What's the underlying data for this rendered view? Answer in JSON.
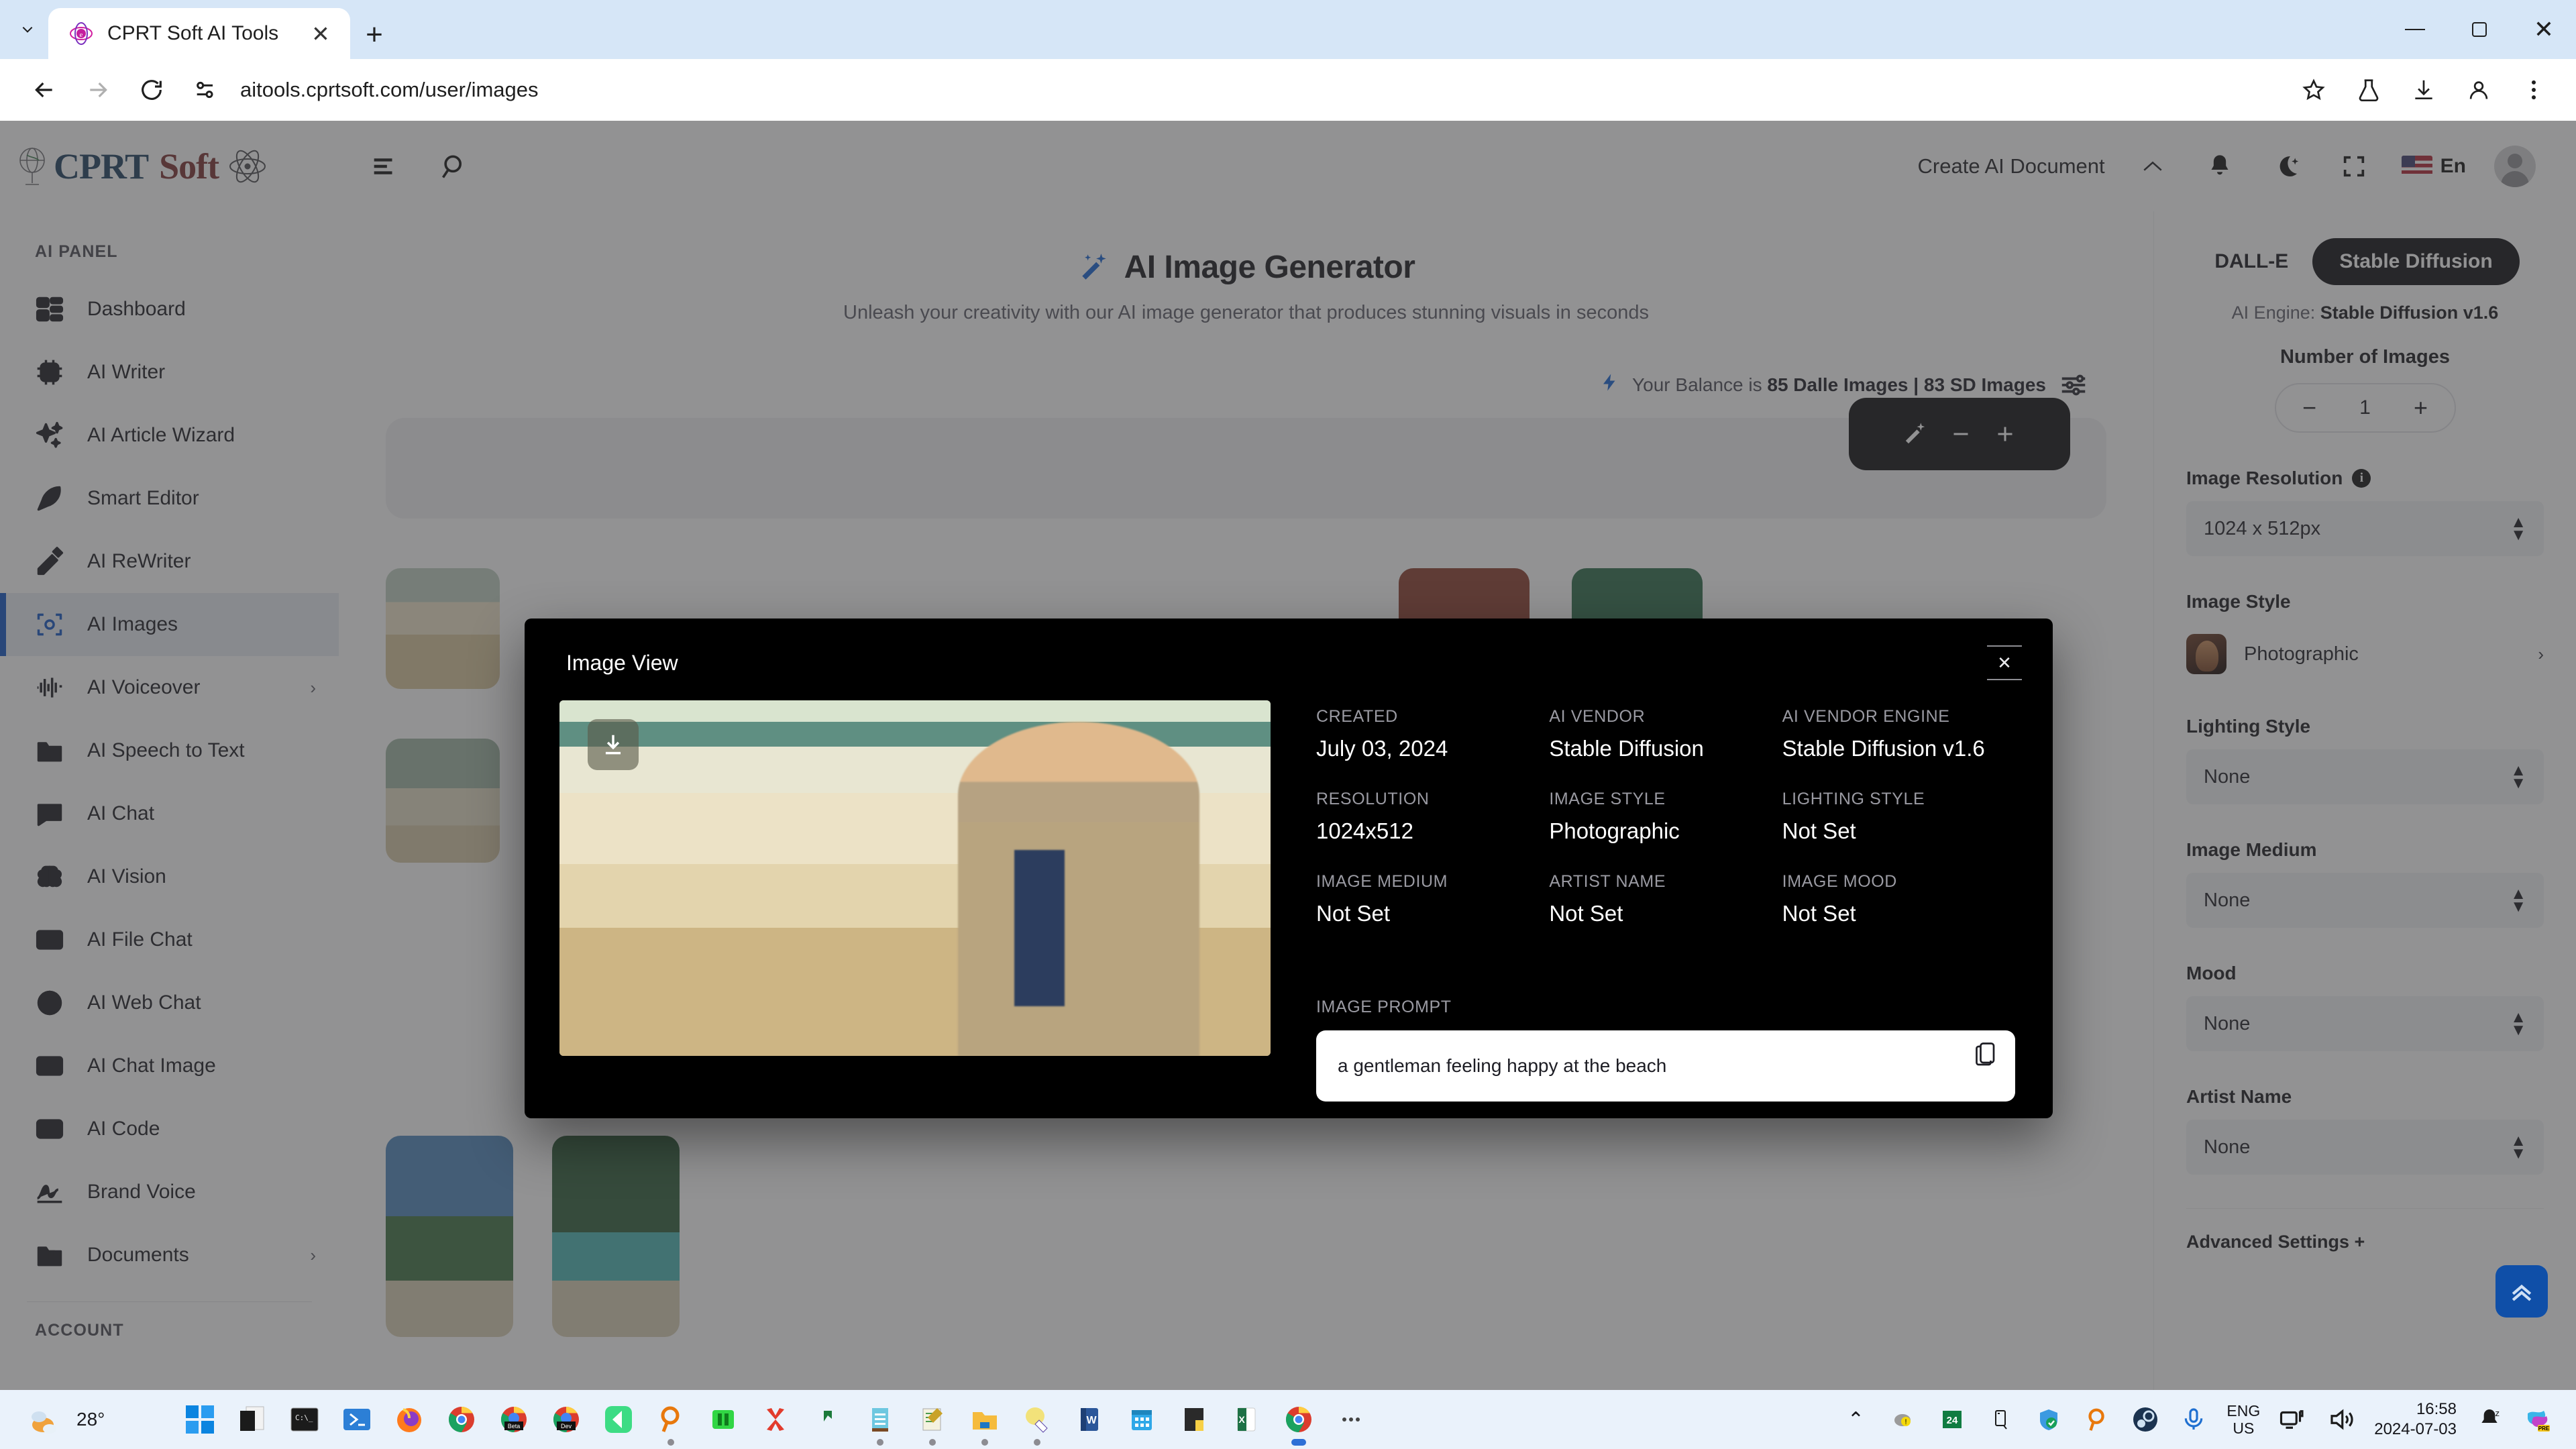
{
  "browser": {
    "tab": {
      "title": "CPRT Soft AI Tools",
      "favicon": "cprt-favicon"
    },
    "new_tab_label": "+",
    "close_label": "✕",
    "url": "aitools.cprtsoft.com/user/images",
    "window_controls": {
      "minimize": "–",
      "maximize": "❐",
      "close": "✕"
    },
    "nav": {
      "back": "←",
      "forward": "→",
      "reload": "↻"
    },
    "toolbar_icons": [
      "bookmark-star-icon",
      "labs-flask-icon",
      "downloads-icon",
      "profile-icon",
      "chrome-menu-icon"
    ]
  },
  "appbar": {
    "brand_first": "CPRT",
    "brand_second": "Soft",
    "create_document": "Create AI Document",
    "chevron": "⌃",
    "language": "En",
    "icons": [
      "menu-icon",
      "search-icon",
      "bell-icon",
      "dark-mode-icon",
      "fullscreen-icon"
    ]
  },
  "sidebar": {
    "panel_heading": "AI PANEL",
    "account_heading": "ACCOUNT",
    "items": [
      {
        "label": "Dashboard",
        "icon": "dashboard-icon",
        "active": false,
        "caret": ""
      },
      {
        "label": "AI Writer",
        "icon": "chip-ai-icon",
        "active": false,
        "caret": ""
      },
      {
        "label": "AI Article Wizard",
        "icon": "sparkles-icon",
        "active": false,
        "caret": ""
      },
      {
        "label": "Smart Editor",
        "icon": "feather-icon",
        "active": false,
        "caret": ""
      },
      {
        "label": "AI ReWriter",
        "icon": "pencil-icon",
        "active": false,
        "caret": ""
      },
      {
        "label": "AI Images",
        "icon": "image-scan-icon",
        "active": true,
        "caret": ""
      },
      {
        "label": "AI Voiceover",
        "icon": "waveform-icon",
        "active": false,
        "caret": "›"
      },
      {
        "label": "AI Speech to Text",
        "icon": "audio-folder-icon",
        "active": false,
        "caret": ""
      },
      {
        "label": "AI Chat",
        "icon": "chat-icon",
        "active": false,
        "caret": ""
      },
      {
        "label": "AI Vision",
        "icon": "brain-icon",
        "active": false,
        "caret": ""
      },
      {
        "label": "AI File Chat",
        "icon": "file-chat-icon",
        "active": false,
        "caret": ""
      },
      {
        "label": "AI Web Chat",
        "icon": "globe-icon",
        "active": false,
        "caret": ""
      },
      {
        "label": "AI Chat Image",
        "icon": "picture-icon",
        "active": false,
        "caret": ""
      },
      {
        "label": "AI Code",
        "icon": "code-icon",
        "active": false,
        "caret": ""
      },
      {
        "label": "Brand Voice",
        "icon": "signature-icon",
        "active": false,
        "caret": ""
      },
      {
        "label": "Documents",
        "icon": "folder-icon",
        "active": false,
        "caret": "›"
      }
    ]
  },
  "main": {
    "title": "AI Image Generator",
    "subtitle": "Unleash your creativity with our AI image generator that produces stunning visuals in seconds",
    "balance_prefix": "Your Balance is ",
    "balance_value": "85 Dalle Images | 83 SD Images",
    "balance_icon": "lightning-bolt-icon",
    "settings_icon": "sliders-icon"
  },
  "right_panel": {
    "engines": [
      {
        "label": "DALL-E",
        "selected": false
      },
      {
        "label": "Stable Diffusion",
        "selected": true
      }
    ],
    "engine_prefix": "AI Engine: ",
    "engine_value": "Stable Diffusion v1.6",
    "number_of_images_label": "Number of Images",
    "number_of_images_value": "1",
    "minus": "−",
    "plus": "+",
    "fields": [
      {
        "label": "Image Resolution",
        "value": "1024 x 512px",
        "info": true
      },
      {
        "label": "Lighting Style",
        "value": "None",
        "info": false
      },
      {
        "label": "Image Medium",
        "value": "None",
        "info": false
      },
      {
        "label": "Mood",
        "value": "None",
        "info": false
      },
      {
        "label": "Artist Name",
        "value": "None",
        "info": false
      }
    ],
    "image_style_label": "Image Style",
    "image_style_value": "Photographic",
    "advanced_settings": "Advanced Settings +",
    "scroll_top_icon": "double-chevron-up-icon"
  },
  "modal": {
    "title": "Image View",
    "close": "✕",
    "download_icon": "download-icon",
    "copy_icon": "copy-icon",
    "meta": [
      {
        "key": "CREATED",
        "value": "July 03, 2024"
      },
      {
        "key": "AI VENDOR",
        "value": "Stable Diffusion"
      },
      {
        "key": "AI VENDOR ENGINE",
        "value": "Stable Diffusion v1.6"
      },
      {
        "key": "RESOLUTION",
        "value": "1024x512"
      },
      {
        "key": "IMAGE STYLE",
        "value": "Photographic"
      },
      {
        "key": "LIGHTING STYLE",
        "value": "Not Set"
      },
      {
        "key": "IMAGE MEDIUM",
        "value": "Not Set"
      },
      {
        "key": "ARTIST NAME",
        "value": "Not Set"
      },
      {
        "key": "IMAGE MOOD",
        "value": "Not Set"
      }
    ],
    "prompt_label": "IMAGE PROMPT",
    "prompt_value": "a gentleman feeling happy at the beach"
  },
  "taskbar": {
    "weather_temp": "28°",
    "keyboard_lang": "ENG",
    "keyboard_region": "US",
    "time": "16:58",
    "date": "2024-07-03",
    "overflow_caret": "⌃",
    "apps": [
      "start-icon",
      "task-view-icon",
      "terminal-icon",
      "powershell-icon",
      "firefox-icon",
      "chrome-icon",
      "chrome-beta-icon",
      "chrome-dev-icon",
      "vscode-icon",
      "search-orange-icon",
      "green-app-icon",
      "xml-red-icon",
      "green-arrow-icon",
      "notebook-icon",
      "notes-icon",
      "folder-icon",
      "paint-icon",
      "word-icon",
      "calendar-icon",
      "sticky-notes-icon",
      "excel-icon",
      "chrome-active-icon",
      "more-icon"
    ],
    "tray": [
      "cloud-warning-icon",
      "calendar-24-icon",
      "usb-icon",
      "defender-icon",
      "search-orange-icon",
      "steam-icon",
      "mic-icon",
      "display-icon",
      "volume-icon",
      "focus-icon",
      "copilot-pre-icon"
    ]
  },
  "colors": {
    "accent": "#1155c4",
    "sidebar_active_bg": "#e8edf4",
    "modal_bg": "#000000",
    "brand_primary": "#1c3f5e",
    "brand_secondary": "#7b3030"
  }
}
